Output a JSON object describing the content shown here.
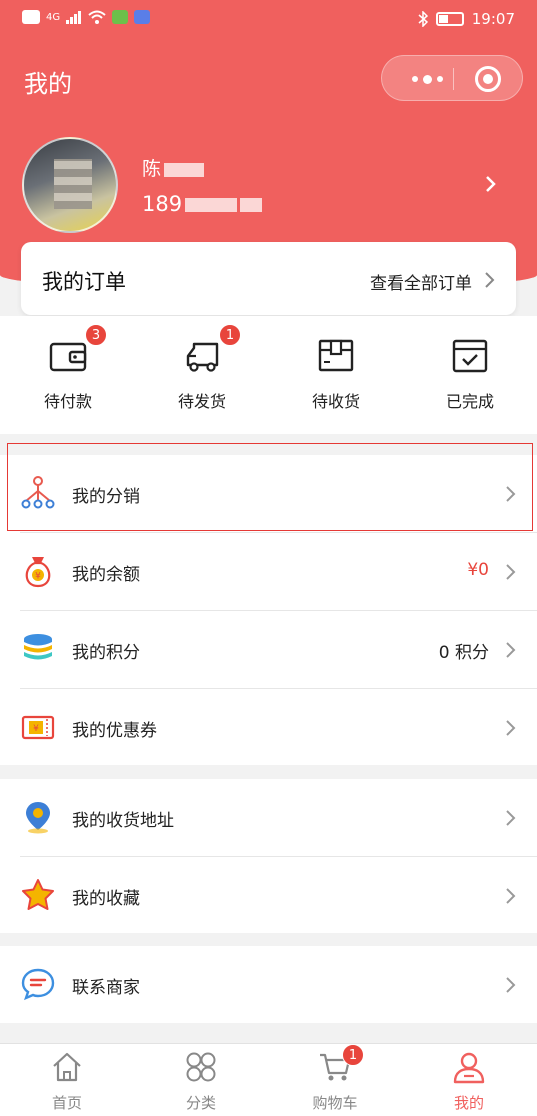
{
  "status_bar": {
    "time": "19:07",
    "network": "4G"
  },
  "nav": {
    "title": "我的"
  },
  "profile": {
    "name_visible": "陈",
    "phone_visible": "189"
  },
  "orders": {
    "title": "我的订单",
    "view_all": "查看全部订单",
    "items": [
      {
        "label": "待付款",
        "badge": "3",
        "icon": "wallet-icon"
      },
      {
        "label": "待发货",
        "badge": "1",
        "icon": "truck-icon"
      },
      {
        "label": "待收货",
        "badge": "",
        "icon": "package-icon"
      },
      {
        "label": "已完成",
        "badge": "",
        "icon": "check-box-icon"
      }
    ]
  },
  "menu": {
    "distribution": {
      "label": "我的分销"
    },
    "balance": {
      "label": "我的余额",
      "value": "¥0"
    },
    "points": {
      "label": "我的积分",
      "value": "0 积分"
    },
    "coupons": {
      "label": "我的优惠券"
    },
    "address": {
      "label": "我的收货地址"
    },
    "favorites": {
      "label": "我的收藏"
    },
    "contact": {
      "label": "联系商家"
    }
  },
  "tabbar": {
    "items": [
      {
        "label": "首页",
        "icon": "home-icon"
      },
      {
        "label": "分类",
        "icon": "grid-icon"
      },
      {
        "label": "购物车",
        "icon": "cart-icon",
        "badge": "1"
      },
      {
        "label": "我的",
        "icon": "user-icon"
      }
    ],
    "active": "我的"
  },
  "colors": {
    "brand": "#f0605e",
    "badge": "#e8453c",
    "highlight_border": "#e53935"
  }
}
